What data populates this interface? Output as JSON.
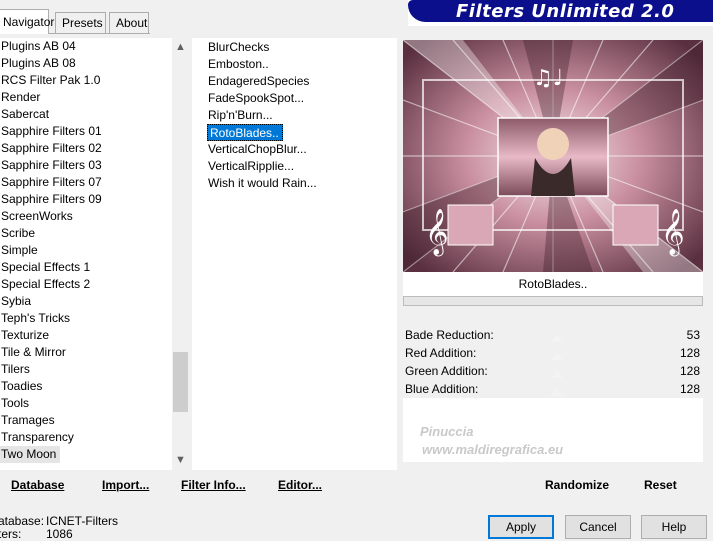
{
  "tabs": [
    {
      "label": "Navigator",
      "active": true
    },
    {
      "label": "Presets",
      "active": false
    },
    {
      "label": "About",
      "active": false
    }
  ],
  "title": "Filters Unlimited 2.0",
  "categories": [
    "Plugins AB 04",
    "Plugins AB 08",
    "RCS Filter Pak 1.0",
    "Render",
    "Sabercat",
    "Sapphire Filters 01",
    "Sapphire Filters 02",
    "Sapphire Filters 03",
    "Sapphire Filters 07",
    "Sapphire Filters 09",
    "ScreenWorks",
    "Scribe",
    "Simple",
    "Special Effects 1",
    "Special Effects 2",
    "Sybia",
    "Teph's Tricks",
    "Texturize",
    "Tile & Mirror",
    "Tilers",
    "Toadies",
    "Tools",
    "Tramages",
    "Transparency",
    "Two Moon"
  ],
  "selected_category": "Two Moon",
  "filters": [
    "BlurChecks",
    "Emboston..",
    "EndageredSpecies",
    "FadeSpookSpot...",
    "Rip'n'Burn...",
    "RotoBlades..",
    "VerticalChopBlur...",
    "VerticalRipplie...",
    "Wish it would Rain..."
  ],
  "selected_filter": "RotoBlades..",
  "preview_filter_name": "RotoBlades..",
  "params": [
    {
      "label": "Bade Reduction:",
      "value": "53"
    },
    {
      "label": "Red Addition:",
      "value": "128"
    },
    {
      "label": "Green Addition:",
      "value": "128"
    },
    {
      "label": "Blue Addition:",
      "value": "128"
    }
  ],
  "left_buttons": {
    "database": "Database",
    "import": "Import...",
    "filter_info": "Filter Info...",
    "editor": "Editor..."
  },
  "right_buttons": {
    "randomize": "Randomize",
    "reset": "Reset"
  },
  "info": {
    "database_label": "atabase:",
    "database_value": "ICNET-Filters",
    "filters_label": "ters:",
    "filters_value": "1086"
  },
  "dialog_buttons": {
    "apply": "Apply",
    "cancel": "Cancel",
    "help": "Help"
  },
  "watermark": {
    "line1": "Pinuccia",
    "line2": "www.maldiregrafica.eu"
  },
  "colors": {
    "title_bar": "#0b0f8c",
    "selection": "#0078d7"
  }
}
